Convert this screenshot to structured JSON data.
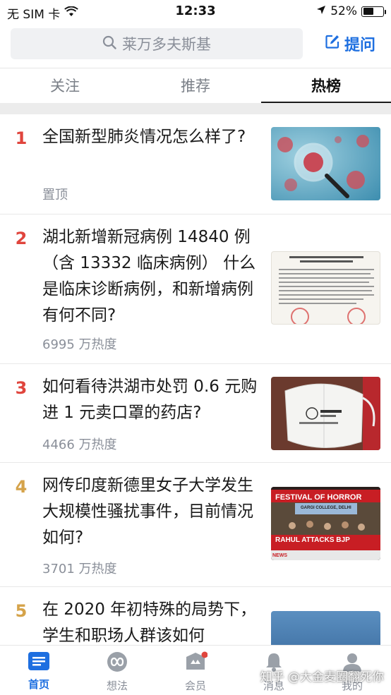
{
  "status_bar": {
    "carrier": "无 SIM 卡",
    "time": "12:33",
    "battery": "52%",
    "battery_level": 0.52,
    "icons": [
      "wifi-icon",
      "location-arrow-icon",
      "battery-icon"
    ]
  },
  "search": {
    "placeholder": "莱万多夫斯基",
    "ask_label": "提问"
  },
  "tabs": [
    {
      "label": "关注",
      "active": false
    },
    {
      "label": "推荐",
      "active": false
    },
    {
      "label": "热榜",
      "active": true
    }
  ],
  "feed": [
    {
      "rank": "1",
      "title": "全国新型肺炎情况怎么样了?",
      "heat": "置顶",
      "thumb": "virus-image"
    },
    {
      "rank": "2",
      "title": "湖北新增新冠病例 14840 例（含 13332 临床病例） 什么是临床诊断病例，和新增病例有何不同?",
      "heat": "6995 万热度",
      "thumb": "document-image"
    },
    {
      "rank": "3",
      "title": "如何看待洪湖市处罚 0.6 元购进 1 元卖口罩的药店?",
      "heat": "4466 万热度",
      "thumb": "mask-image"
    },
    {
      "rank": "4",
      "title": "网传印度新德里女子大学发生大规模性骚扰事件，目前情况如何?",
      "heat": "3701 万热度",
      "thumb": "news-screenshot-image",
      "thumb_text": {
        "banner": "FESTIVAL OF HORROR",
        "sub": "GARGI COLLEGE, DELHI",
        "ticker": "RAHUL ATTACKS BJP",
        "tag": "NEWS"
      }
    },
    {
      "rank": "5",
      "title": "在 2020 年初特殊的局势下，学生和职场人群该如何",
      "heat": "",
      "thumb": "blue-image"
    }
  ],
  "tabbar": [
    {
      "label": "首页",
      "icon": "home-list-icon",
      "active": true
    },
    {
      "label": "想法",
      "icon": "infinity-icon",
      "active": false
    },
    {
      "label": "会员",
      "icon": "crown-icon",
      "active": false
    },
    {
      "label": "消息",
      "icon": "bell-icon",
      "active": false
    },
    {
      "label": "我的",
      "icon": "person-icon",
      "active": false
    }
  ],
  "watermark": "知乎 @大金麦圈翻死你",
  "colors": {
    "accent": "#1e6fe0",
    "rank_hot": "#e0453d",
    "rank_warm": "#d5a34a"
  }
}
